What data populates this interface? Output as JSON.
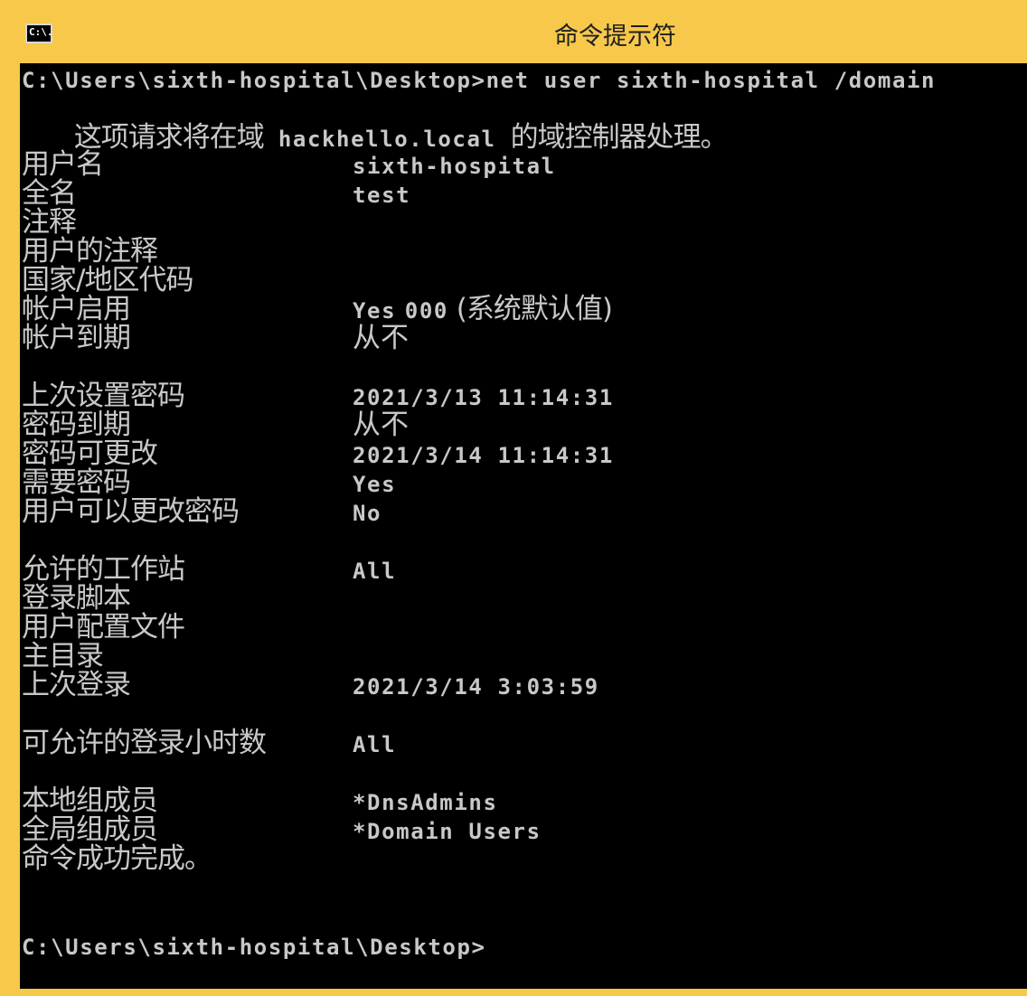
{
  "window": {
    "title": "命令提示符",
    "icon": "C:\\."
  },
  "console": {
    "command_line": "C:\\Users\\sixth-hospital\\Desktop>net user sixth-hospital /domain",
    "notice_prefix": "这项请求将在域",
    "notice_domain": " hackhello.local ",
    "notice_suffix": "的域控制器处理。",
    "fields": {
      "user_name_label": "用户名",
      "user_name_value": "sixth-hospital",
      "full_name_label": "全名",
      "full_name_value": "test",
      "comment_label": "注释",
      "user_comment_label": "用户的注释",
      "country_code_label": "国家/地区代码",
      "country_code_value": "000",
      "country_code_note": " (系统默认值)",
      "account_active_label": "帐户启用",
      "account_active_value": "Yes",
      "account_expires_label": "帐户到期",
      "account_expires_value": "从不",
      "password_last_set_label": "上次设置密码",
      "password_last_set_value": "2021/3/13 11:14:31",
      "password_expires_label": "密码到期",
      "password_expires_value": "从不",
      "password_changeable_label": "密码可更改",
      "password_changeable_value": "2021/3/14 11:14:31",
      "password_required_label": "需要密码",
      "password_required_value": "Yes",
      "user_may_change_label": "用户可以更改密码",
      "user_may_change_value": "No",
      "workstations_label": "允许的工作站",
      "workstations_value": "All",
      "logon_script_label": "登录脚本",
      "profile_label": "用户配置文件",
      "home_dir_label": "主目录",
      "last_logon_label": "上次登录",
      "last_logon_value": "2021/3/14 3:03:59",
      "logon_hours_label": "可允许的登录小时数",
      "logon_hours_value": "All",
      "local_groups_label": "本地组成员",
      "local_groups_value": "*DnsAdmins",
      "global_groups_label": "全局组成员",
      "global_groups_value": "*Domain Users"
    },
    "success_message": "命令成功完成。",
    "prompt": "C:\\Users\\sixth-hospital\\Desktop>"
  }
}
